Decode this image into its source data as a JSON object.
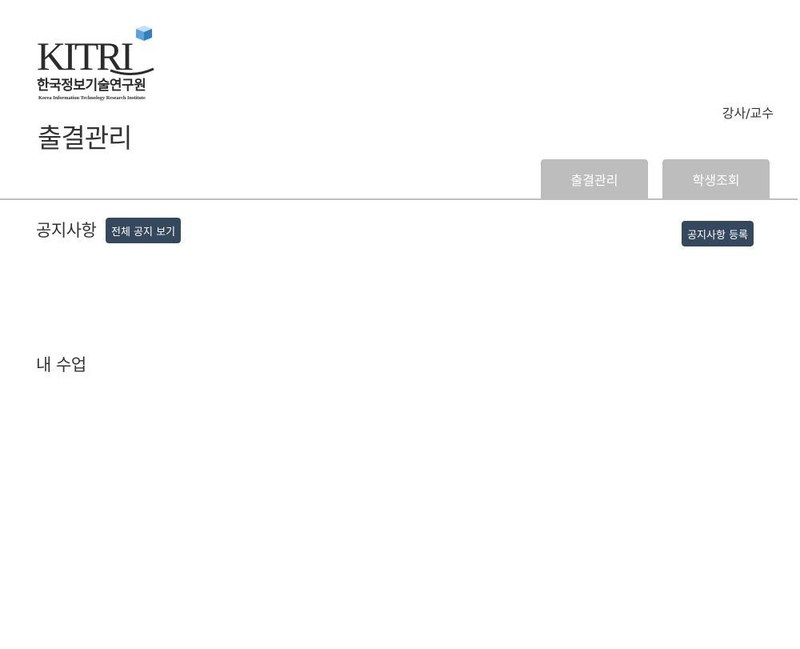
{
  "logo": {
    "wordmark": "KITRI",
    "name_ko": "한국정보기술연구원",
    "name_en": "Korea Information Technology Research Institute"
  },
  "header": {
    "role_label": "강사/교수",
    "page_title": "출결관리"
  },
  "nav": {
    "tabs": [
      {
        "label": "출결관리"
      },
      {
        "label": "학생조회"
      }
    ],
    "tab_color": "#bdbdbd"
  },
  "notice": {
    "heading": "공지사항",
    "view_all_label": "전체 공지 보기",
    "register_label": "공지사항 등록"
  },
  "classes": {
    "heading": "내 수업"
  },
  "colors": {
    "button_dark": "#34495e",
    "logo_cube_light": "#8fc3ea",
    "logo_cube_dark": "#2f7fc4",
    "text": "#333333"
  }
}
